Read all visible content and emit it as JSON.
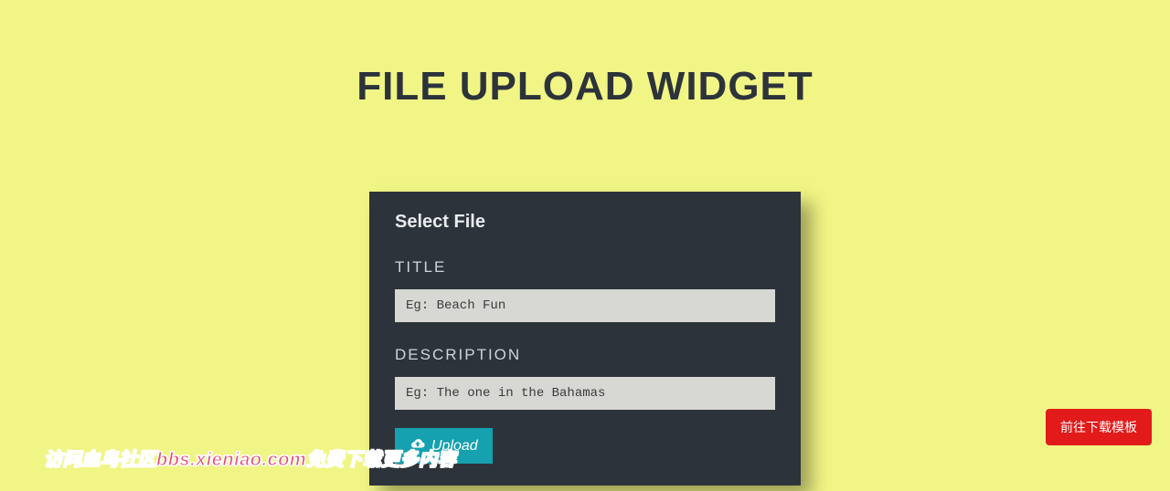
{
  "page": {
    "title": "FILE UPLOAD WIDGET"
  },
  "card": {
    "header": "Select File",
    "title_label": "TITLE",
    "title_placeholder": "Eg: Beach Fun",
    "title_value": "",
    "desc_label": "DESCRIPTION",
    "desc_placeholder": "Eg: The one in the Bahamas",
    "desc_value": "",
    "upload_label": "Upload"
  },
  "floating_button": {
    "label": "前往下载模板"
  },
  "watermark": {
    "text": "访问血鸟社区bbs.xieniao.com免费下载更多内容"
  },
  "colors": {
    "background": "#f1f585",
    "card": "#2d333a",
    "input_bg": "#d7d7d3",
    "upload_btn": "#15a1af",
    "float_btn": "#e21a1a",
    "watermark": "#e64b7a"
  }
}
